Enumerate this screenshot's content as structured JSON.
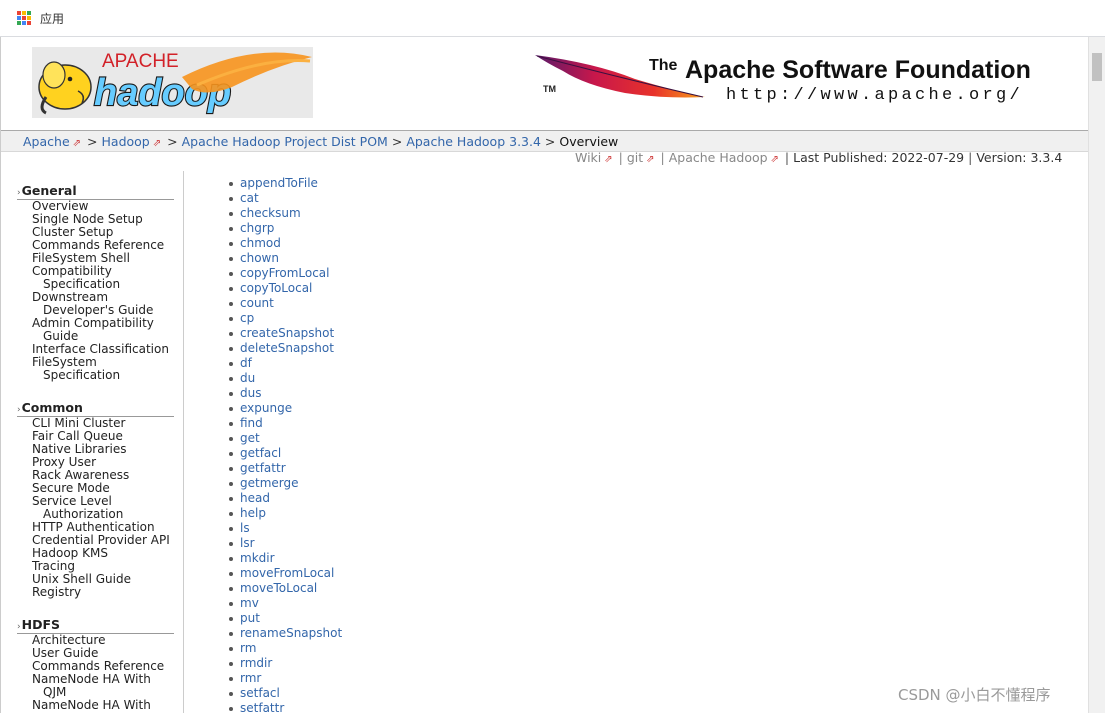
{
  "browser": {
    "apps_label": "应用",
    "apps_colors": [
      "#ea4335",
      "#fbbc04",
      "#34a853",
      "#4285f4",
      "#ea4335",
      "#fbbc04",
      "#34a853",
      "#4285f4",
      "#ea4335"
    ]
  },
  "banner": {
    "hadoop_logo": {
      "apache": "APACHE",
      "hadoop": "hadoop"
    },
    "asf_logo": {
      "the": "The",
      "title": "Apache Software Foundation",
      "url": "http://www.apache.org/",
      "tm": "TM"
    }
  },
  "breadcrumbs": {
    "items": [
      {
        "label": "Apache",
        "external": true
      },
      {
        "label": "Hadoop",
        "external": true
      },
      {
        "label": "Apache Hadoop Project Dist POM",
        "external": false
      },
      {
        "label": "Apache Hadoop 3.3.4",
        "external": false
      }
    ],
    "current": "Overview",
    "separator": ">"
  },
  "meta": {
    "wiki": "Wiki",
    "git": "git",
    "apache_hadoop": "Apache Hadoop",
    "published": "Last Published: 2022-07-29",
    "version": "Version: 3.3.4"
  },
  "menu": {
    "general": {
      "title": "General",
      "items": [
        {
          "label": "Overview"
        },
        {
          "label": "Single Node Setup"
        },
        {
          "label": "Cluster Setup"
        },
        {
          "label": "Commands Reference"
        },
        {
          "label": "FileSystem Shell"
        },
        {
          "label": "Compatibility",
          "cont": "Specification"
        },
        {
          "label": "Downstream",
          "cont": "Developer's Guide"
        },
        {
          "label": "Admin Compatibility",
          "cont": "Guide"
        },
        {
          "label": "Interface Classification"
        },
        {
          "label": "FileSystem",
          "cont": "Specification"
        }
      ]
    },
    "common": {
      "title": "Common",
      "items": [
        {
          "label": "CLI Mini Cluster"
        },
        {
          "label": "Fair Call Queue"
        },
        {
          "label": "Native Libraries"
        },
        {
          "label": "Proxy User"
        },
        {
          "label": "Rack Awareness"
        },
        {
          "label": "Secure Mode"
        },
        {
          "label": "Service Level",
          "cont": "Authorization"
        },
        {
          "label": "HTTP Authentication"
        },
        {
          "label": "Credential Provider API"
        },
        {
          "label": "Hadoop KMS"
        },
        {
          "label": "Tracing"
        },
        {
          "label": "Unix Shell Guide"
        },
        {
          "label": "Registry"
        }
      ]
    },
    "hdfs": {
      "title": "HDFS",
      "items": [
        {
          "label": "Architecture"
        },
        {
          "label": "User Guide"
        },
        {
          "label": "Commands Reference"
        },
        {
          "label": "NameNode HA With",
          "cont": "QJM"
        },
        {
          "label": "NameNode HA With"
        }
      ]
    }
  },
  "commands": [
    "appendToFile",
    "cat",
    "checksum",
    "chgrp",
    "chmod",
    "chown",
    "copyFromLocal",
    "copyToLocal",
    "count",
    "cp",
    "createSnapshot",
    "deleteSnapshot",
    "df",
    "du",
    "dus",
    "expunge",
    "find",
    "get",
    "getfacl",
    "getfattr",
    "getmerge",
    "head",
    "help",
    "ls",
    "lsr",
    "mkdir",
    "moveFromLocal",
    "moveToLocal",
    "mv",
    "put",
    "renameSnapshot",
    "rm",
    "rmdir",
    "rmr",
    "setfacl",
    "setfattr"
  ],
  "watermark": "CSDN @小白不懂程序"
}
